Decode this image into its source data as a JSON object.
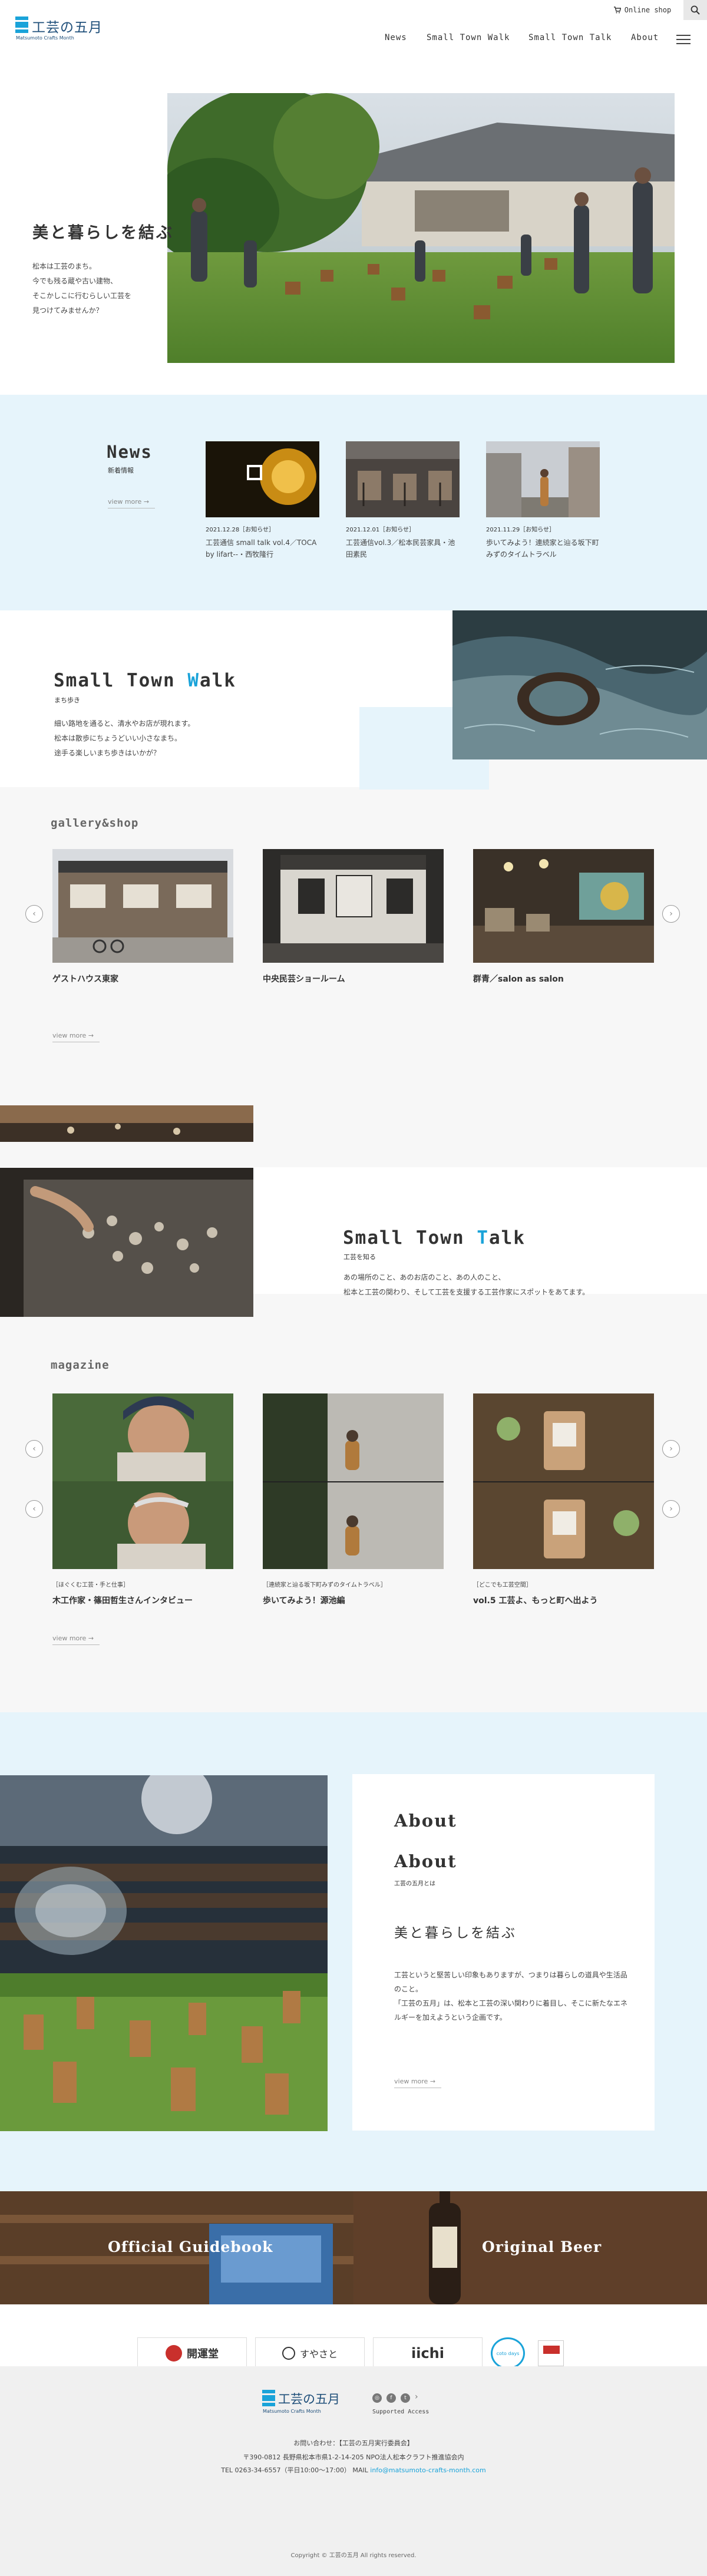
{
  "header": {
    "logo_text": "工芸の五月",
    "logo_sub": "Matsumoto Crafts Month",
    "shop_label": "Online shop",
    "nav": [
      "News",
      "Small Town Walk",
      "Small Town Talk",
      "About"
    ]
  },
  "hero": {
    "title": "美と暮らしを結ぶ",
    "lines": [
      "松本は工芸のまち。",
      "今でも残る蔵や古い建物、",
      "そこかしこに行むらしい工芸を",
      "見つけてみませんか？"
    ],
    "slides": 3,
    "active_slide": 1
  },
  "news": {
    "heading": "News",
    "sub": "新着情報",
    "view_more": "view more →",
    "items": [
      {
        "date": "2021.12.28［お知らせ］",
        "title": "工芸通信 small talk vol.4／TOCA by lifart--・西牧隆行"
      },
      {
        "date": "2021.12.01［お知らせ］",
        "title": "工芸通信vol.3／松本民芸家具・池田素民"
      },
      {
        "date": "2021.11.29［お知らせ］",
        "title": "歩いてみよう！連続家と辿る坂下町みずのタイムトラベル"
      }
    ]
  },
  "walk": {
    "heading": "Small Town Walk",
    "heading_accent_char": "W",
    "sub": "まち歩き",
    "lines": [
      "細い路地を通ると、清水やお店が現れます。",
      "松本は散歩にちょうどいい小さなまち。",
      "途手る楽しいまち歩きはいかが？"
    ]
  },
  "gallery": {
    "heading": "gallery&shop",
    "view_more": "view more →",
    "items": [
      {
        "label": "ゲストハウス東家"
      },
      {
        "label": "中央民芸ショールーム"
      },
      {
        "label": "群青／salon as salon"
      }
    ]
  },
  "talk": {
    "heading": "Small Town Talk",
    "heading_accent_char": "T",
    "sub": "工芸を知る",
    "lines": [
      "あの場所のこと、あのお店のこと、あの人のこと、",
      "松本と工芸の関わり、そして工芸を支援する工芸作家にスポットをあてます。"
    ]
  },
  "magazine": {
    "heading": "magazine",
    "view_more": "view more →",
    "items": [
      {
        "tag": "［ほぐくむ工芸・手と仕事］",
        "title": "木工作家・篠田哲生さんインタビュー"
      },
      {
        "tag": "［連続家と辿る坂下町みずのタイムトラベル］",
        "title": "歩いてみよう！源池編"
      },
      {
        "tag": "［どこでも工芸空間］",
        "title": "vol.5 工芸よ、もっと町へ出よう"
      }
    ]
  },
  "about": {
    "heading1": "About",
    "heading2": "About",
    "sub": "工芸の五月とは",
    "title": "美と暮らしを結ぶ",
    "lines": [
      "工芸というと堅苦しい印象もありますが、つまりは暮らしの道具や生活品のこと。",
      "「工芸の五月」は、松本と工芸の深い関わりに着目し、そこに新たなエネルギーを加えようという企画です。"
    ],
    "view_more": "view more →"
  },
  "banners": {
    "left": "Official Guidebook",
    "right": "Original Beer"
  },
  "sponsors": [
    "開運堂",
    "すやさと",
    "iichi",
    "coto days",
    ""
  ],
  "footer": {
    "logo_text": "工芸の五月",
    "logo_sub": "Matsumoto Crafts Month",
    "supported": "Supported Access",
    "contact_title": "お問い合わせ：【工芸の五月実行委員会】",
    "address": "〒390-0812 長野県松本市県1-2-14-205 NPO法人松本クラフト推進協会内",
    "tel": "TEL 0263-34-6557（平日10:00〜17:00） MAIL ",
    "mail": "info@matsumoto-crafts-month.com",
    "copyright": "Copyright © 工芸の五月 All rights reserved."
  }
}
